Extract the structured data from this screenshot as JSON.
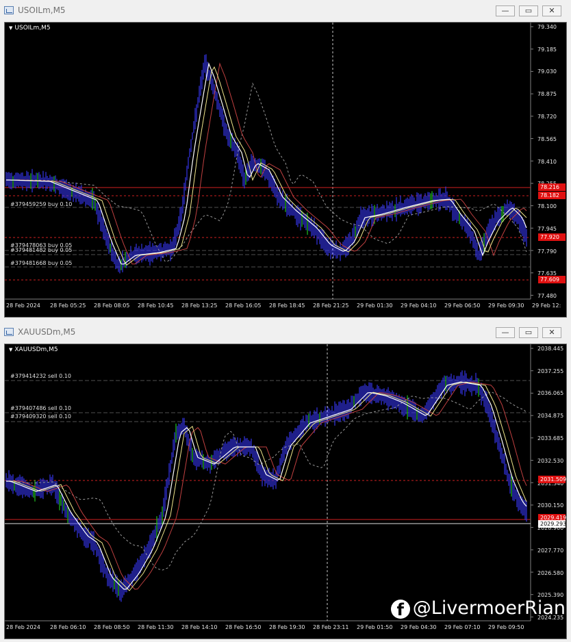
{
  "windows": [
    {
      "title": "USOILm,M5",
      "symbol_label": "USOILm,M5",
      "price_labels": [
        "79.340",
        "79.185",
        "79.030",
        "78.875",
        "78.720",
        "78.565",
        "78.410",
        "78.255",
        "78.100",
        "77.945",
        "77.790",
        "77.635",
        "77.480"
      ],
      "time_labels": [
        "28 Feb 2024",
        "28 Feb 05:25",
        "28 Feb 08:05",
        "28 Feb 10:45",
        "28 Feb 13:25",
        "28 Feb 16:05",
        "28 Feb 18:45",
        "28 Feb 21:25",
        "29 Feb 01:30",
        "29 Feb 04:10",
        "29 Feb 06:50",
        "29 Feb 09:30",
        "29 Feb 12:"
      ],
      "orders": [
        "#379459259 buy 0.10",
        "#379478063 buy 0.05",
        "#379481482 buy 0.05",
        "#379481668 buy 0.05"
      ],
      "badges": [
        {
          "text": "78.216",
          "bg": "#e01010",
          "fg": "#ffffff"
        },
        {
          "text": "78.182",
          "bg": "#e01010",
          "fg": "#ffffff"
        },
        {
          "text": "77.920",
          "bg": "#e01010",
          "fg": "#ffffff"
        },
        {
          "text": "77.609",
          "bg": "#e01010",
          "fg": "#ffffff"
        }
      ]
    },
    {
      "title": "XAUUSDm,M5",
      "symbol_label": "XAUUSDm,M5",
      "price_labels": [
        "2038.445",
        "2037.255",
        "2036.065",
        "2034.875",
        "2033.685",
        "2032.530",
        "2031.340",
        "2030.150",
        "2028.960",
        "2027.770",
        "2026.580",
        "2025.390",
        "2024.235"
      ],
      "time_labels": [
        "28 Feb 2024",
        "28 Feb 06:10",
        "28 Feb 08:50",
        "28 Feb 11:30",
        "28 Feb 14:10",
        "28 Feb 16:50",
        "28 Feb 19:30",
        "28 Feb 23:11",
        "29 Feb 01:50",
        "29 Feb 04:30",
        "29 Feb 07:10",
        "29 Feb 09:50"
      ],
      "orders": [
        "#379414232 sell 0.10",
        "#379407486 sell 0.10",
        "#379409320 sell 0.10"
      ],
      "badges": [
        {
          "text": "2031.509",
          "bg": "#e01010",
          "fg": "#ffffff"
        },
        {
          "text": "2029.419",
          "bg": "#e01010",
          "fg": "#ffffff"
        },
        {
          "text": "2029.293",
          "bg": "#ffffff",
          "fg": "#000000"
        }
      ]
    }
  ],
  "window_buttons": {
    "minimize": "—",
    "restore": "▭",
    "close": "✕"
  },
  "watermark": {
    "icon": "f",
    "text": "@LivermoerRian"
  },
  "colors": {
    "candle": "#3a3ae8",
    "ma_fast": "#ffffff",
    "ma_mid": "#f0e68c",
    "ma_slow": "#c04040",
    "ma_long": "#a0a0a0",
    "order_line": "#c03030"
  }
}
